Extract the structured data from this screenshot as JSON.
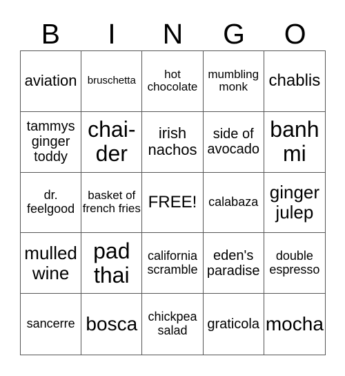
{
  "header": [
    "B",
    "I",
    "N",
    "G",
    "O"
  ],
  "cells": [
    [
      "aviation",
      "bruschetta",
      "hot chocolate",
      "mumbling monk",
      "chablis"
    ],
    [
      "tammys ginger toddy",
      "chai-der",
      "irish nachos",
      "side of avocado",
      "banh mi"
    ],
    [
      "dr. feelgood",
      "basket of french fries",
      "FREE!",
      "calabaza",
      "ginger julep"
    ],
    [
      "mulled wine",
      "pad thai",
      "california scramble",
      "eden's paradise",
      "double espresso"
    ],
    [
      "sancerre",
      "bosca",
      "chickpea salad",
      "graticola",
      "mocha"
    ]
  ]
}
